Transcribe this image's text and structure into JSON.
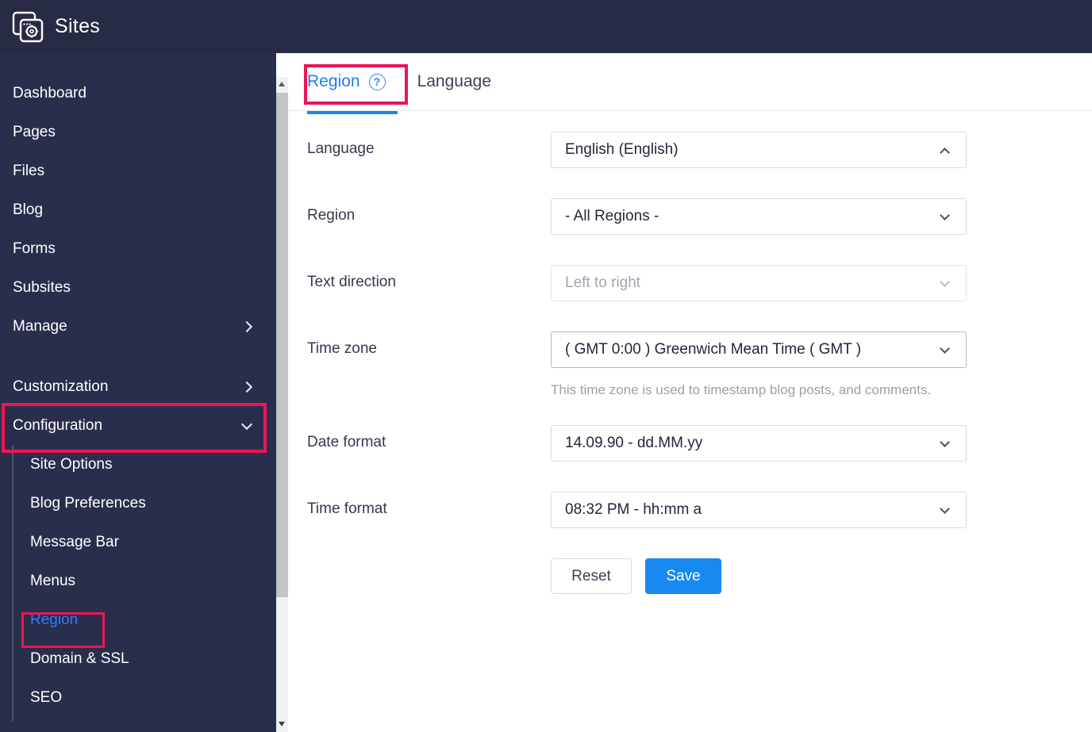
{
  "app": {
    "title": "Sites"
  },
  "sidebar": {
    "items": [
      {
        "label": "Dashboard"
      },
      {
        "label": "Pages"
      },
      {
        "label": "Files"
      },
      {
        "label": "Blog"
      },
      {
        "label": "Forms"
      },
      {
        "label": "Subsites"
      },
      {
        "label": "Manage",
        "chevron": "right"
      }
    ],
    "sections": [
      {
        "label": "Customization",
        "chevron": "right"
      },
      {
        "label": "Configuration",
        "chevron": "down",
        "annotated": true
      }
    ],
    "config_subitems": [
      {
        "label": "Site Options"
      },
      {
        "label": "Blog Preferences"
      },
      {
        "label": "Message Bar"
      },
      {
        "label": "Menus"
      },
      {
        "label": "Region",
        "active": true,
        "annotated": true
      },
      {
        "label": "Domain & SSL"
      },
      {
        "label": "SEO"
      }
    ]
  },
  "tabs": [
    {
      "label": "Region",
      "active": true,
      "help_icon_glyph": "?"
    },
    {
      "label": "Language",
      "active": false
    }
  ],
  "form": {
    "fields": [
      {
        "label": "Language",
        "value": "English (English)",
        "chevron": "up",
        "state": "normal"
      },
      {
        "label": "Region",
        "value": "- All Regions -",
        "chevron": "down",
        "state": "normal"
      },
      {
        "label": "Text direction",
        "value": "Left to right",
        "chevron": "down",
        "state": "disabled"
      },
      {
        "label": "Time zone",
        "value": "( GMT 0:00 ) Greenwich Mean Time ( GMT )",
        "chevron": "down",
        "state": "focus",
        "helper": "This time zone is used to timestamp blog posts, and comments."
      },
      {
        "label": "Date format",
        "value": "14.09.90 - dd.MM.yy",
        "chevron": "down",
        "state": "normal"
      },
      {
        "label": "Time format",
        "value": "08:32 PM - hh:mm a",
        "chevron": "down",
        "state": "normal"
      }
    ],
    "buttons": {
      "reset": "Reset",
      "save": "Save"
    }
  },
  "colors": {
    "header_bg": "#272b46",
    "sidebar_bg": "#2a2e4d",
    "accent_blue": "#1e7bf0",
    "save_blue": "#1789f0",
    "annotation_red": "#ec1555",
    "helper_gray": "#99a0a8"
  }
}
